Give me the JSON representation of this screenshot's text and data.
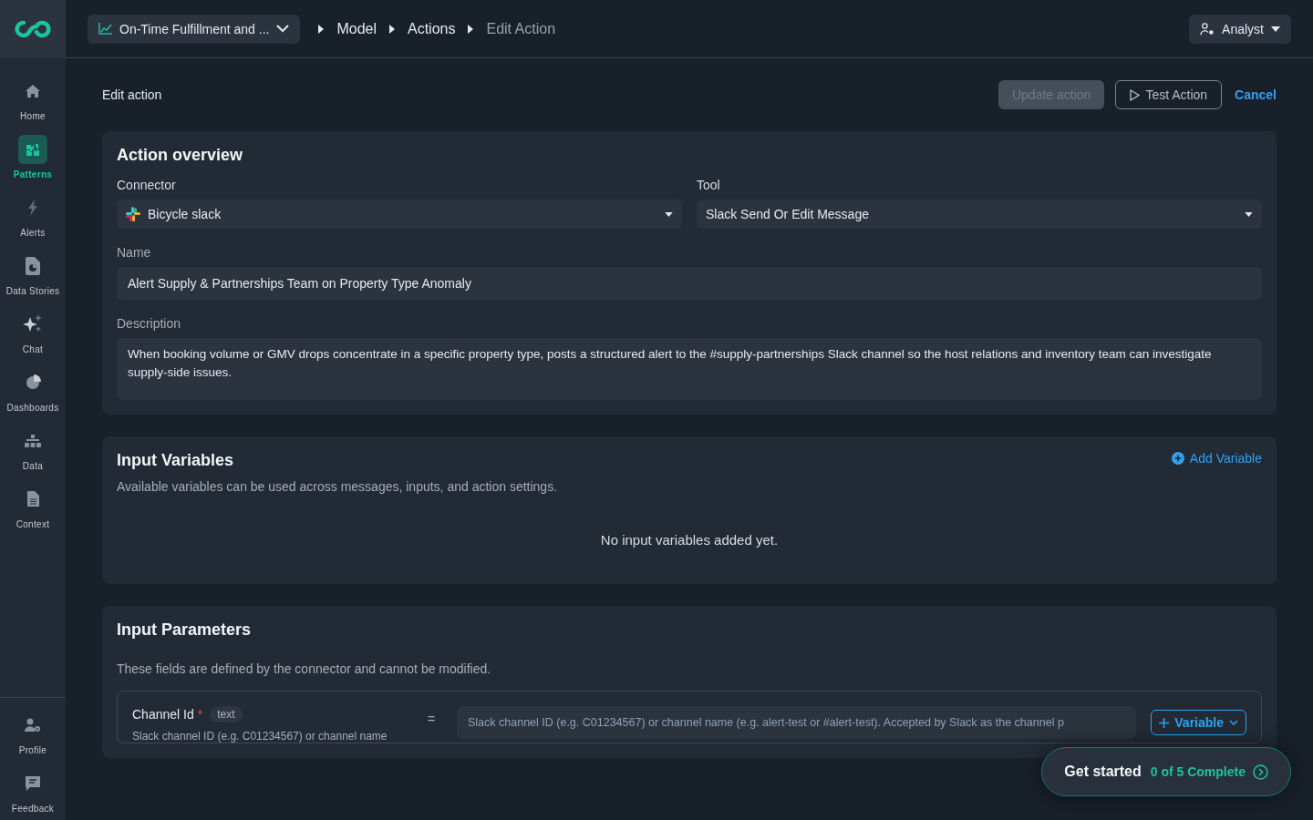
{
  "sidebar": {
    "items": [
      {
        "label": "Home",
        "selected": false
      },
      {
        "label": "Patterns",
        "selected": true
      },
      {
        "label": "Alerts",
        "selected": false
      },
      {
        "label": "Data Stories",
        "selected": false
      },
      {
        "label": "Chat",
        "selected": false
      },
      {
        "label": "Dashboards",
        "selected": false
      },
      {
        "label": "Data",
        "selected": false
      },
      {
        "label": "Context",
        "selected": false
      }
    ],
    "bottom_items": [
      {
        "label": "Profile"
      },
      {
        "label": "Feedback"
      }
    ]
  },
  "header": {
    "model_selector": "On-Time Fulfillment and ...",
    "breadcrumbs": [
      {
        "label": "Model",
        "current": false
      },
      {
        "label": "Actions",
        "current": false
      },
      {
        "label": "Edit Action",
        "current": true
      }
    ],
    "role_menu": "Analyst"
  },
  "page": {
    "title": "Edit action",
    "buttons": [
      {
        "label": "Update action",
        "kind": "primary",
        "disabled": true
      },
      {
        "label": "Test Action",
        "kind": "outline",
        "disabled": false
      },
      {
        "label": "Cancel",
        "kind": "link",
        "disabled": false
      }
    ]
  },
  "overview": {
    "title": "Action overview",
    "connector": {
      "label": "Connector",
      "value": "Bicycle slack"
    },
    "tool": {
      "label": "Tool",
      "value": "Slack Send Or Edit Message"
    },
    "name": {
      "label": "Name",
      "value": "Alert Supply & Partnerships Team on Property Type Anomaly"
    },
    "description": {
      "label": "Description",
      "value": "When booking volume or GMV drops concentrate in a specific property type, posts a structured alert to the #supply-partnerships Slack channel so the host relations and inventory team can investigate supply-side issues."
    }
  },
  "input_variables": {
    "title": "Input Variables",
    "add_button": "Add Variable",
    "subtitle": "Available variables can be used across messages, inputs, and action settings.",
    "empty_message": "No input variables added yet."
  },
  "input_parameters": {
    "title": "Input Parameters",
    "subtitle": "These fields are defined by the connector and cannot be modified.",
    "params": [
      {
        "name": "Channel Id",
        "required": true,
        "required_mark": "*",
        "type": "text",
        "help": "Slack channel ID (e.g. C01234567) or channel name",
        "operator": "=",
        "placeholder": "Slack channel ID (e.g. C01234567) or channel name (e.g. alert-test or #alert-test). Accepted by Slack as the channel p",
        "variable_button": "Variable"
      }
    ]
  },
  "onboarding": {
    "title": "Get started",
    "progress": "0 of 5 Complete"
  }
}
